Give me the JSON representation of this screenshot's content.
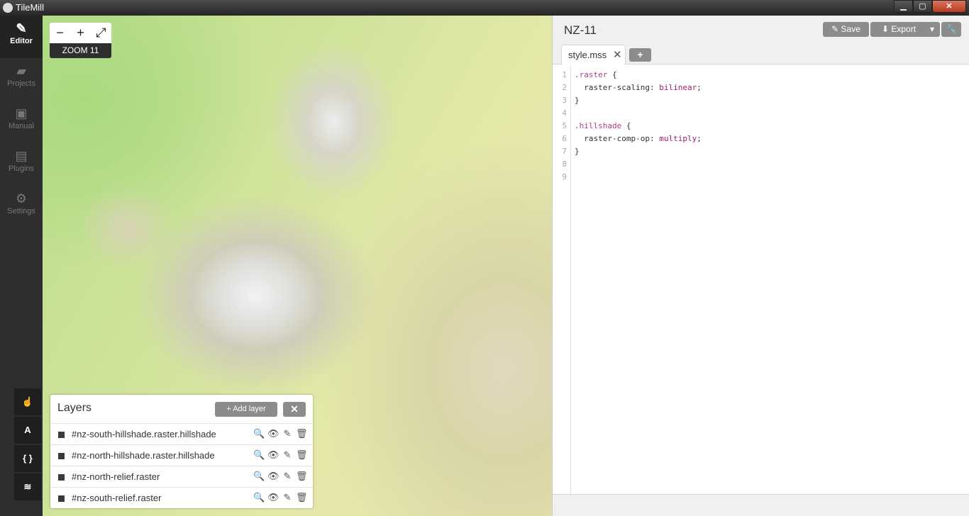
{
  "window": {
    "title": "TileMill",
    "minimize": "▁",
    "maximize": "▢",
    "close": "✕"
  },
  "sidebar": {
    "items": [
      {
        "label": "Editor",
        "icon": "pencil-icon",
        "glyph": "✎",
        "active": true
      },
      {
        "label": "Projects",
        "icon": "folder-icon",
        "glyph": "▰",
        "active": false
      },
      {
        "label": "Manual",
        "icon": "book-icon",
        "glyph": "▣",
        "active": false
      },
      {
        "label": "Plugins",
        "icon": "plugin-icon",
        "glyph": "▤",
        "active": false
      },
      {
        "label": "Settings",
        "icon": "gear-icon",
        "glyph": "⚙",
        "active": false
      }
    ],
    "tools": [
      {
        "name": "pointer-tool",
        "glyph": "☝"
      },
      {
        "name": "font-tool",
        "glyph": "A"
      },
      {
        "name": "carto-tool",
        "glyph": "{ }"
      },
      {
        "name": "layers-tool",
        "glyph": "≋"
      }
    ]
  },
  "map": {
    "zoom_out": "−",
    "zoom_in": "+",
    "fullscreen": "⤢",
    "zoom_label": "ZOOM 11"
  },
  "layers": {
    "title": "Layers",
    "add_label": "+  Add layer",
    "close": "✕",
    "items": [
      {
        "name": "#nz-south-hillshade.raster.hillshade"
      },
      {
        "name": "#nz-north-hillshade.raster.hillshade"
      },
      {
        "name": "#nz-north-relief.raster"
      },
      {
        "name": "#nz-south-relief.raster"
      }
    ],
    "action_glyphs": {
      "inspect": "🔍",
      "visible": "👁",
      "edit": "✎",
      "delete": "🗑"
    }
  },
  "editor": {
    "project_title": "NZ-11",
    "save_label": "✎  Save",
    "export_label": "⬇  Export",
    "export_dropdown": "▾",
    "settings_glyph": "🔧",
    "tab_label": "style.mss",
    "tab_close": "✕",
    "new_tab": "+",
    "code_lines": [
      {
        "n": "1",
        "parts": [
          [
            "sel",
            ".raster"
          ],
          [
            "",
            " {"
          ]
        ]
      },
      {
        "n": "2",
        "parts": [
          [
            "",
            "  raster-scaling: "
          ],
          [
            "val",
            "bilinear"
          ],
          [
            "",
            ";"
          ]
        ]
      },
      {
        "n": "3",
        "parts": [
          [
            "",
            "}"
          ]
        ]
      },
      {
        "n": "4",
        "parts": []
      },
      {
        "n": "5",
        "parts": [
          [
            "sel",
            ".hillshade"
          ],
          [
            "",
            " {"
          ]
        ]
      },
      {
        "n": "6",
        "parts": [
          [
            "",
            "  raster-comp-op: "
          ],
          [
            "val",
            "multiply"
          ],
          [
            "",
            ";"
          ]
        ]
      },
      {
        "n": "7",
        "parts": [
          [
            "",
            "}"
          ]
        ]
      },
      {
        "n": "8",
        "parts": []
      },
      {
        "n": "9",
        "parts": []
      }
    ]
  }
}
